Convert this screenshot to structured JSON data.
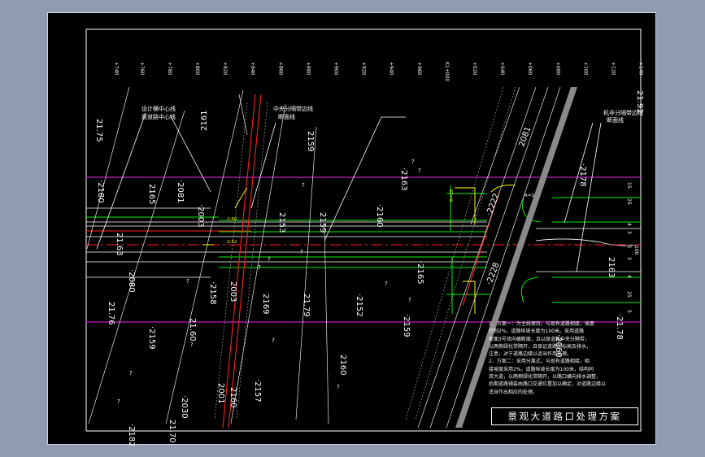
{
  "drawing": {
    "title": "景观大道路口处理方案",
    "stations": [
      "+740",
      "+760",
      "+780",
      "+800",
      "+820",
      "+840",
      "+860",
      "+880",
      "+900",
      "+920",
      "+940",
      "+960",
      "K1+000",
      "+020",
      "+040",
      "+060",
      "+080",
      "+100",
      "+120",
      "+140"
    ],
    "station_positions": [
      0.052,
      0.098,
      0.148,
      0.198,
      0.248,
      0.298,
      0.348,
      0.398,
      0.448,
      0.498,
      0.548,
      0.598,
      0.648,
      0.698,
      0.748,
      0.798,
      0.848,
      0.898,
      0.948,
      0.998
    ],
    "callouts": {
      "left_line1": "设计横中心线",
      "left_line2": "原道路中心线",
      "median_line1": "中央分隔带边线",
      "median_line2": "断面线",
      "right_line1": "机非分隔带边线",
      "right_line2": "断面线"
    },
    "elevations": [
      "21.75",
      "·2180",
      "2165",
      "·2081",
      "21.63",
      "·2080",
      "21.76",
      "·2159",
      "21.60",
      "2161",
      "·2158",
      "2159",
      "2153",
      "2159",
      "·2163",
      "·2160",
      "·2165",
      "·2159",
      "21.79",
      "·2152",
      "2169",
      "2160",
      "·2157",
      "2160",
      "2003",
      "2001",
      "·2030",
      "·2182",
      "21.70",
      "·2003",
      "2081",
      "·2222",
      "·2228",
      "·2060",
      "·2178",
      "21.92",
      "2163",
      "·21.78"
    ],
    "dimensions": [
      "15",
      "25",
      "4",
      "3",
      "1",
      "3",
      "4",
      "25",
      "5",
      "100"
    ],
    "small_labels": [
      "2:50",
      "2:52",
      "R=25",
      "R=3"
    ],
    "notes": [
      "1、方案一：为主线保持，与现有道路相接，坡度",
      "控制2%，道路纵坡长度为100米。采用道路",
      "断面3号双向横断面，且以原道路中央分隔带，",
      "以两侧绿化带隔开，且保证道路的标高及排水，",
      "注意，对于道路边缘以适当作用处理。",
      "2、方案二：采用分离式，与现有道路相接，相",
      "接坡度采用2%，道路纵坡长度为100米，结构同",
      "双大道，以两侧绿化带隔开，以路口横向排水调整，",
      "后期道路铺装由路口交通位置加以确定，对道路边缘以",
      "适当作出相应的处理。"
    ]
  },
  "colors": {
    "background": "#000000",
    "red": "#ff2020",
    "magenta": "#c020c0",
    "green": "#00ee00",
    "yellow": "#ffff00",
    "white": "#ffffff",
    "gray": "#8a8a8a"
  }
}
